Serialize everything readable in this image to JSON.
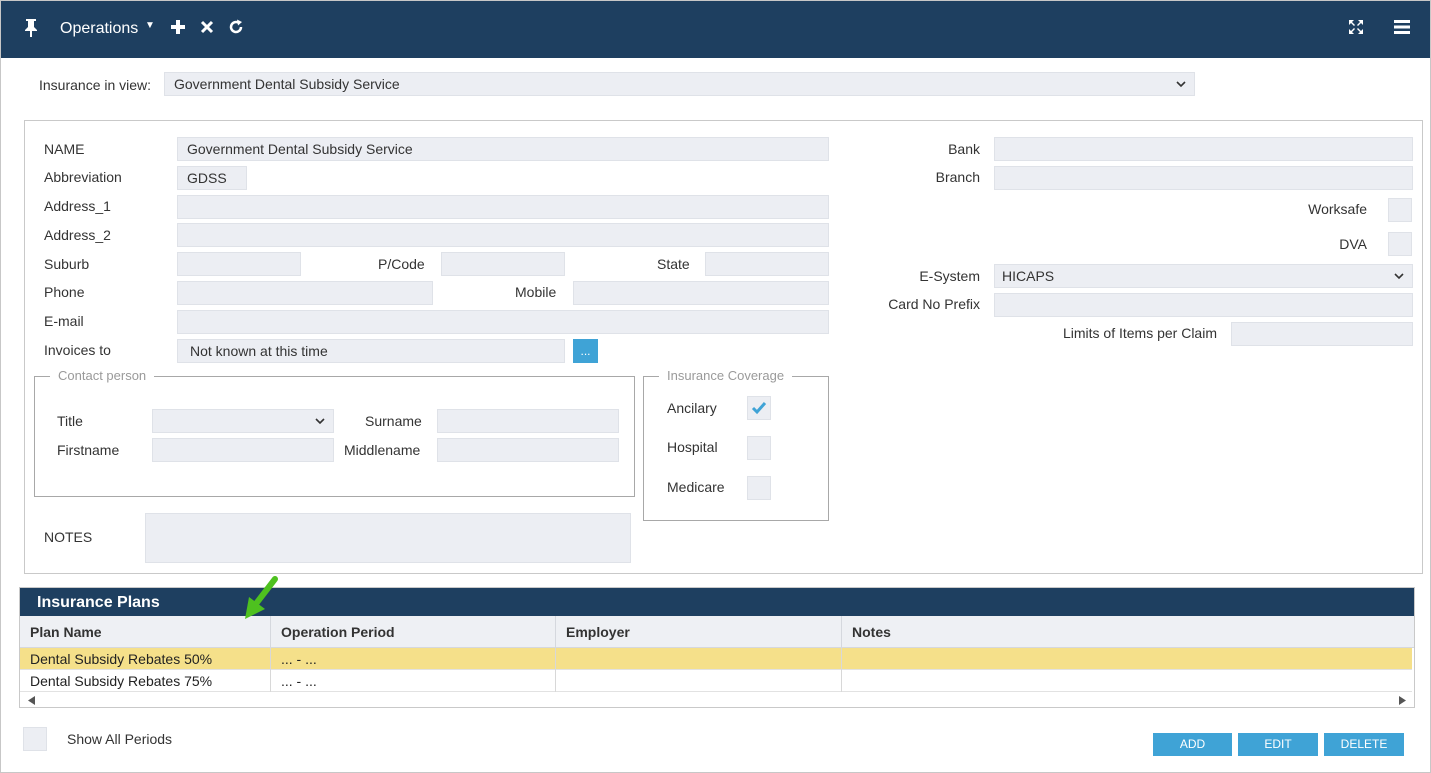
{
  "toolbar": {
    "title": "Operations",
    "icons": [
      "pin-icon",
      "plus-icon",
      "close-icon",
      "refresh-icon",
      "expand-icon",
      "menu-icon"
    ]
  },
  "insurance_in_view": {
    "label": "Insurance in view:",
    "value": "Government Dental Subsidy Service"
  },
  "form": {
    "name_label": "NAME",
    "name_value": "Government Dental Subsidy Service",
    "abbreviation_label": "Abbreviation",
    "abbreviation_value": "GDSS",
    "address1_label": "Address_1",
    "address1_value": "",
    "address2_label": "Address_2",
    "address2_value": "",
    "suburb_label": "Suburb",
    "suburb_value": "",
    "pcode_label": "P/Code",
    "pcode_value": "",
    "state_label": "State",
    "state_value": "",
    "phone_label": "Phone",
    "phone_value": "",
    "mobile_label": "Mobile",
    "mobile_value": "",
    "email_label": "E-mail",
    "email_value": "",
    "invoices_label": "Invoices to",
    "invoices_value": "Not known at this time",
    "invoices_button": "...",
    "notes_label": "NOTES",
    "notes_value": "",
    "bank_label": "Bank",
    "bank_value": "",
    "branch_label": "Branch",
    "branch_value": "",
    "worksafe_label": "Worksafe",
    "dva_label": "DVA",
    "esystem_label": "E-System",
    "esystem_value": "HICAPS",
    "cardprefix_label": "Card No Prefix",
    "cardprefix_value": "",
    "limits_label": "Limits of Items per Claim",
    "limits_value": ""
  },
  "contact": {
    "legend": "Contact person",
    "title_label": "Title",
    "title_value": "",
    "surname_label": "Surname",
    "surname_value": "",
    "firstname_label": "Firstname",
    "firstname_value": "",
    "middlename_label": "Middlename",
    "middlename_value": ""
  },
  "coverage": {
    "legend": "Insurance Coverage",
    "ancilary_label": "Ancilary",
    "ancilary_checked": true,
    "hospital_label": "Hospital",
    "hospital_checked": false,
    "medicare_label": "Medicare",
    "medicare_checked": false
  },
  "plans": {
    "title": "Insurance Plans",
    "columns": [
      "Plan Name",
      "Operation Period",
      "Employer",
      "Notes"
    ],
    "rows": [
      {
        "plan": "Dental Subsidy Rebates 50%",
        "period": "... - ...",
        "employer": "",
        "notes": ""
      },
      {
        "plan": "Dental Subsidy Rebates 75%",
        "period": "... - ...",
        "employer": "",
        "notes": ""
      }
    ],
    "selected_row": 0
  },
  "footer": {
    "show_all_periods_label": "Show All Periods",
    "add_label": "ADD",
    "edit_label": "EDIT",
    "delete_label": "DELETE"
  },
  "colors": {
    "header": "#1e3f60",
    "accent": "#3fa3d6",
    "selected_row": "#f5e08a",
    "arrow": "#4ec11f"
  }
}
